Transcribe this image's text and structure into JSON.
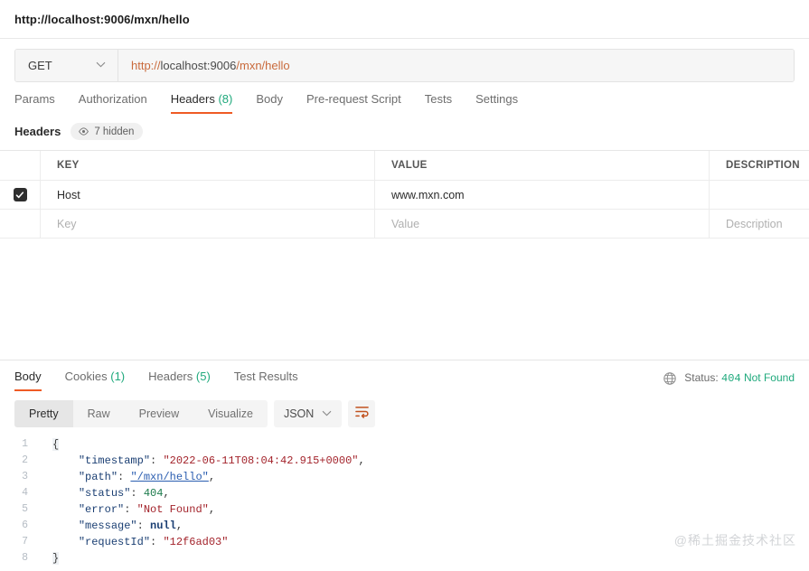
{
  "titlebar": {
    "tab_title": "http://localhost:9006/mxn/hello"
  },
  "request": {
    "method": "GET",
    "method_caret": "chevron-down",
    "url_full": "http://localhost:9006/mxn/hello",
    "url_proto": "http://",
    "url_host": "localhost:9006",
    "url_path": "/mxn/hello"
  },
  "request_tabs": [
    {
      "label": "Params",
      "count": "",
      "active": false
    },
    {
      "label": "Authorization",
      "count": "",
      "active": false
    },
    {
      "label": "Headers",
      "count": "(8)",
      "active": true
    },
    {
      "label": "Body",
      "count": "",
      "active": false
    },
    {
      "label": "Pre-request Script",
      "count": "",
      "active": false
    },
    {
      "label": "Tests",
      "count": "",
      "active": false
    },
    {
      "label": "Settings",
      "count": "",
      "active": false
    }
  ],
  "headers_section": {
    "label": "Headers",
    "hidden_badge": "7 hidden"
  },
  "headers_table": {
    "columns": [
      "KEY",
      "VALUE",
      "DESCRIPTION"
    ],
    "rows": [
      {
        "checked": true,
        "key": "Host",
        "value": "www.mxn.com",
        "description": ""
      }
    ],
    "placeholder_row": {
      "key": "Key",
      "value": "Value",
      "description": "Description"
    }
  },
  "response_tabs": [
    {
      "label": "Body",
      "count": "",
      "active": true
    },
    {
      "label": "Cookies",
      "count": "(1)",
      "active": false
    },
    {
      "label": "Headers",
      "count": "(5)",
      "active": false
    },
    {
      "label": "Test Results",
      "count": "",
      "active": false
    }
  ],
  "response_status": {
    "prefix": "Status:",
    "code": "404",
    "phrase": "Not Found"
  },
  "body_toolbar": {
    "views": [
      {
        "label": "Pretty",
        "active": true
      },
      {
        "label": "Raw",
        "active": false
      },
      {
        "label": "Preview",
        "active": false
      },
      {
        "label": "Visualize",
        "active": false
      }
    ],
    "format": "JSON",
    "format_caret": "chevron-down",
    "wrap_icon": "wrap-lines-icon"
  },
  "response_body": {
    "language": "json",
    "line_numbers": [
      "1",
      "2",
      "3",
      "4",
      "5",
      "6",
      "7",
      "8"
    ],
    "lines": [
      {
        "raw": "{"
      },
      {
        "key": "\"timestamp\"",
        "value": "\"2022-06-11T08:04:42.915+0000\"",
        "type": "string",
        "comma": true
      },
      {
        "key": "\"path\"",
        "value": "\"/mxn/hello\"",
        "type": "link",
        "comma": true
      },
      {
        "key": "\"status\"",
        "value": "404",
        "type": "number",
        "comma": true
      },
      {
        "key": "\"error\"",
        "value": "\"Not Found\"",
        "type": "string",
        "comma": true
      },
      {
        "key": "\"message\"",
        "value": "null",
        "type": "null",
        "comma": true
      },
      {
        "key": "\"requestId\"",
        "value": "\"12f6ad03\"",
        "type": "string",
        "comma": false
      },
      {
        "raw": "}"
      }
    ],
    "parsed": {
      "timestamp": "2022-06-11T08:04:42.915+0000",
      "path": "/mxn/hello",
      "status": 404,
      "error": "Not Found",
      "message": null,
      "requestId": "12f6ad03"
    }
  },
  "watermark": {
    "text": "@稀土掘金技术社区"
  },
  "colors": {
    "accent_orange": "#ef5b25",
    "count_green": "#1fa97c",
    "status_green": "#1fa97c",
    "json_key": "#1b3f73",
    "json_string": "#a3232b",
    "json_number": "#1b7a4b",
    "json_link": "#2a5db0"
  }
}
